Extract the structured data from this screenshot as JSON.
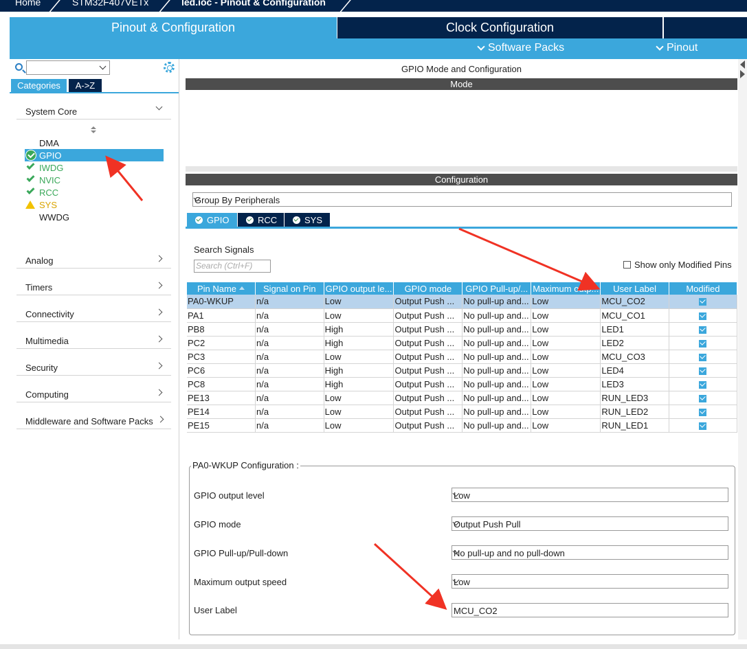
{
  "breadcrumb": [
    "Home",
    "STM32F407VETx",
    "led.ioc - Pinout & Configuration"
  ],
  "tabs": {
    "pinout": "Pinout & Configuration",
    "clock": "Clock Configuration"
  },
  "subtabs": {
    "software_packs": "Software Packs",
    "pinout": "Pinout"
  },
  "left": {
    "category_tabs": [
      "Categories",
      "A->Z"
    ],
    "sections": [
      "System Core",
      "Analog",
      "Timers",
      "Connectivity",
      "Multimedia",
      "Security",
      "Computing",
      "Middleware and Software Packs"
    ],
    "system_core_items": [
      {
        "label": "DMA",
        "status": "none"
      },
      {
        "label": "GPIO",
        "status": "ok-selected"
      },
      {
        "label": "IWDG",
        "status": "ok"
      },
      {
        "label": "NVIC",
        "status": "ok"
      },
      {
        "label": "RCC",
        "status": "ok"
      },
      {
        "label": "SYS",
        "status": "warning"
      },
      {
        "label": "WWDG",
        "status": "none"
      }
    ]
  },
  "right": {
    "title": "GPIO Mode and Configuration",
    "mode_header": "Mode",
    "config_header": "Configuration",
    "group_by": "Group By Peripherals",
    "periph_tabs": [
      "GPIO",
      "RCC",
      "SYS"
    ],
    "search_label": "Search Signals",
    "search_placeholder": "Search (Ctrl+F)",
    "show_modified": "Show only Modified Pins",
    "columns": [
      "Pin Name",
      "Signal on Pin",
      "GPIO output le...",
      "GPIO mode",
      "GPIO Pull-up/...",
      "Maximum outp...",
      "User Label",
      "Modified"
    ],
    "rows": [
      [
        "PA0-WKUP",
        "n/a",
        "Low",
        "Output Push ...",
        "No pull-up and...",
        "Low",
        "MCU_CO2"
      ],
      [
        "PA1",
        "n/a",
        "Low",
        "Output Push ...",
        "No pull-up and...",
        "Low",
        "MCU_CO1"
      ],
      [
        "PB8",
        "n/a",
        "High",
        "Output Push ...",
        "No pull-up and...",
        "Low",
        "LED1"
      ],
      [
        "PC2",
        "n/a",
        "High",
        "Output Push ...",
        "No pull-up and...",
        "Low",
        "LED2"
      ],
      [
        "PC3",
        "n/a",
        "Low",
        "Output Push ...",
        "No pull-up and...",
        "Low",
        "MCU_CO3"
      ],
      [
        "PC6",
        "n/a",
        "High",
        "Output Push ...",
        "No pull-up and...",
        "Low",
        "LED4"
      ],
      [
        "PC8",
        "n/a",
        "High",
        "Output Push ...",
        "No pull-up and...",
        "Low",
        "LED3"
      ],
      [
        "PE13",
        "n/a",
        "Low",
        "Output Push ...",
        "No pull-up and...",
        "Low",
        "RUN_LED3"
      ],
      [
        "PE14",
        "n/a",
        "Low",
        "Output Push ...",
        "No pull-up and...",
        "Low",
        "RUN_LED2"
      ],
      [
        "PE15",
        "n/a",
        "Low",
        "Output Push ...",
        "No pull-up and...",
        "Low",
        "RUN_LED1"
      ]
    ],
    "pin_config": {
      "title": "PA0-WKUP Configuration :",
      "fields": [
        {
          "label": "GPIO output level",
          "value": "Low"
        },
        {
          "label": "GPIO mode",
          "value": "Output Push Pull"
        },
        {
          "label": "GPIO Pull-up/Pull-down",
          "value": "No pull-up and no pull-down"
        },
        {
          "label": "Maximum output speed",
          "value": "Low"
        },
        {
          "label": "User Label",
          "value": "MCU_CO2"
        }
      ]
    }
  },
  "colors": {
    "accent": "#3ba7dc",
    "navy": "#03234b",
    "ok": "#3aa85a",
    "warn": "#f2c200",
    "annotation": "#f03224"
  }
}
